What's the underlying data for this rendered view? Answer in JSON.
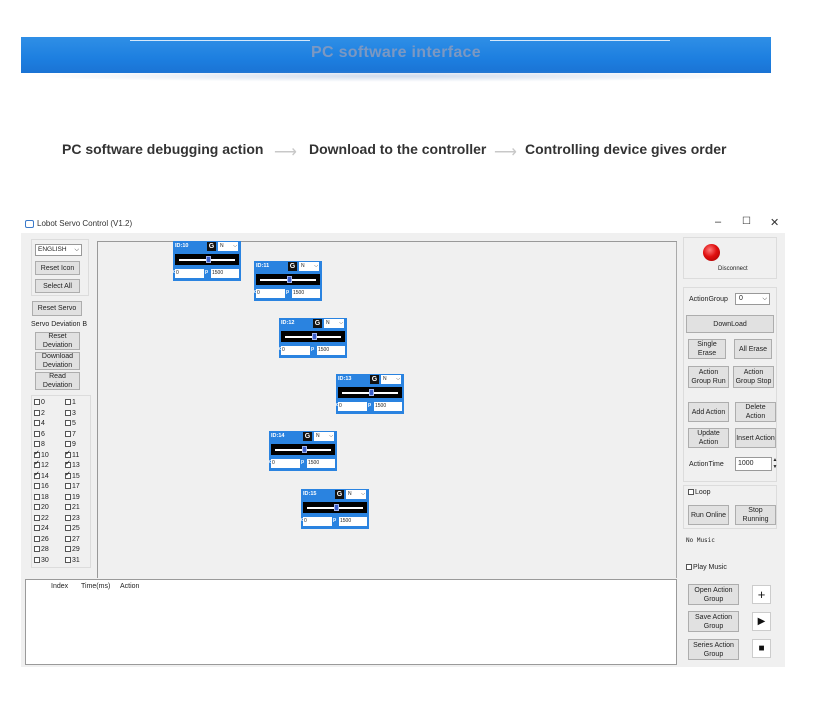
{
  "banner": {
    "title": "PC software interface"
  },
  "flow": {
    "step1": "PC software debugging action",
    "step2": "Download to the controller",
    "step3": "Controlling device gives order",
    "arrow": "⟶"
  },
  "window": {
    "title": "Lobot Servo Control (V1.2)",
    "controls": {
      "minimize": "–",
      "maximize": "☐",
      "close": "✕"
    }
  },
  "left_panel": {
    "language": "ENGLISH",
    "reset_icon": "Reset Icon",
    "select_all": "Select All",
    "reset_servo": "Reset Servo",
    "servo_deviation": "Servo Deviation B",
    "reset_deviation": "Reset Deviation",
    "download_deviation": "Download Deviation",
    "read_deviation": "Read Deviation",
    "checkboxes": [
      {
        "label": "0",
        "checked": false
      },
      {
        "label": "1",
        "checked": false
      },
      {
        "label": "2",
        "checked": false
      },
      {
        "label": "3",
        "checked": false
      },
      {
        "label": "4",
        "checked": false
      },
      {
        "label": "5",
        "checked": false
      },
      {
        "label": "6",
        "checked": false
      },
      {
        "label": "7",
        "checked": false
      },
      {
        "label": "8",
        "checked": false
      },
      {
        "label": "9",
        "checked": false
      },
      {
        "label": "10",
        "checked": true
      },
      {
        "label": "11",
        "checked": true
      },
      {
        "label": "12",
        "checked": true
      },
      {
        "label": "13",
        "checked": true
      },
      {
        "label": "14",
        "checked": true
      },
      {
        "label": "15",
        "checked": true
      },
      {
        "label": "16",
        "checked": false
      },
      {
        "label": "17",
        "checked": false
      },
      {
        "label": "18",
        "checked": false
      },
      {
        "label": "19",
        "checked": false
      },
      {
        "label": "20",
        "checked": false
      },
      {
        "label": "21",
        "checked": false
      },
      {
        "label": "22",
        "checked": false
      },
      {
        "label": "23",
        "checked": false
      },
      {
        "label": "24",
        "checked": false
      },
      {
        "label": "25",
        "checked": false
      },
      {
        "label": "26",
        "checked": false
      },
      {
        "label": "27",
        "checked": false
      },
      {
        "label": "28",
        "checked": false
      },
      {
        "label": "29",
        "checked": false
      },
      {
        "label": "30",
        "checked": false
      },
      {
        "label": "31",
        "checked": false
      }
    ]
  },
  "servos": [
    {
      "id": "ID:10",
      "g": "G",
      "mode": "N",
      "dev": "0",
      "val": "1500"
    },
    {
      "id": "ID:11",
      "g": "G",
      "mode": "N",
      "dev": "0",
      "val": "1500"
    },
    {
      "id": "ID:12",
      "g": "G",
      "mode": "N",
      "dev": "0",
      "val": "1500"
    },
    {
      "id": "ID:13",
      "g": "G",
      "mode": "N",
      "dev": "0",
      "val": "1500"
    },
    {
      "id": "ID:14",
      "g": "G",
      "mode": "N",
      "dev": "0",
      "val": "1500"
    },
    {
      "id": "ID:15",
      "g": "G",
      "mode": "N",
      "dev": "0",
      "val": "1500"
    }
  ],
  "servo_labels": {
    "d": "d",
    "p": "p"
  },
  "table": {
    "columns": [
      "Index",
      "Time(ms)",
      "Action"
    ]
  },
  "right_panel": {
    "disconnect": "Disconnect",
    "action_group_label": "ActionGroup",
    "action_group_value": "0",
    "download": "DownLoad",
    "single_erase": "Single Erase",
    "all_erase": "All Erase",
    "action_group_run": "Action Group Run",
    "action_group_stop": "Action Group Stop",
    "add_action": "Add Action",
    "delete_action": "Delete Action",
    "update_action": "Update Action",
    "insert_action": "Insert Action",
    "action_time_label": "ActionTime",
    "action_time_value": "1000",
    "loop": "Loop",
    "run_online": "Run Online",
    "stop_running": "Stop Running",
    "no_music": "No Music",
    "play_music": "Play Music",
    "open_action_group": "Open Action Group",
    "save_action_group": "Save Action Group",
    "series_action_group": "Series Action Group",
    "icons": {
      "add": "+",
      "play": "▶",
      "stop": "■"
    }
  }
}
